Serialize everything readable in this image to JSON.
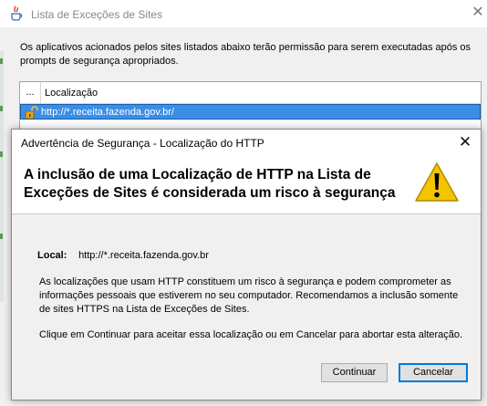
{
  "bg_window": {
    "title": "Lista de Exceções de Sites",
    "description": "Os aplicativos acionados pelos sites listados abaixo terão permissão para serem executadas após os prompts de segurança apropriados.",
    "table": {
      "col_dots": "...",
      "col_location": "Localização",
      "rows": [
        {
          "url": "http://*.receita.fazenda.gov.br/"
        }
      ]
    }
  },
  "dialog": {
    "title": "Advertência de Segurança - Localização do HTTP",
    "heading": "A inclusão de uma Localização de HTTP na Lista de Exceções de Sites é considerada um risco à segurança",
    "location_label": "Local:",
    "location_value": "http://*.receita.fazenda.gov.br",
    "paragraph1": "As localizações que usam HTTP constituem um risco à segurança e podem comprometer as informações pessoais que estiverem no seu computador. Recomendamos a inclusão somente de sites HTTPS na Lista de Exceções de Sites.",
    "paragraph2": "Clique em Continuar para aceitar essa localização ou em Cancelar para abortar esta alteração.",
    "buttons": {
      "continue": "Continuar",
      "cancel": "Cancelar"
    }
  },
  "colors": {
    "selection": "#3a8ee6",
    "warning_yellow": "#f5c400",
    "focus_border": "#0078d7"
  },
  "icons": {
    "app": "java-icon",
    "row": "unlocked-padlock-icon",
    "warning": "warning-triangle-icon",
    "close": "close-icon"
  }
}
